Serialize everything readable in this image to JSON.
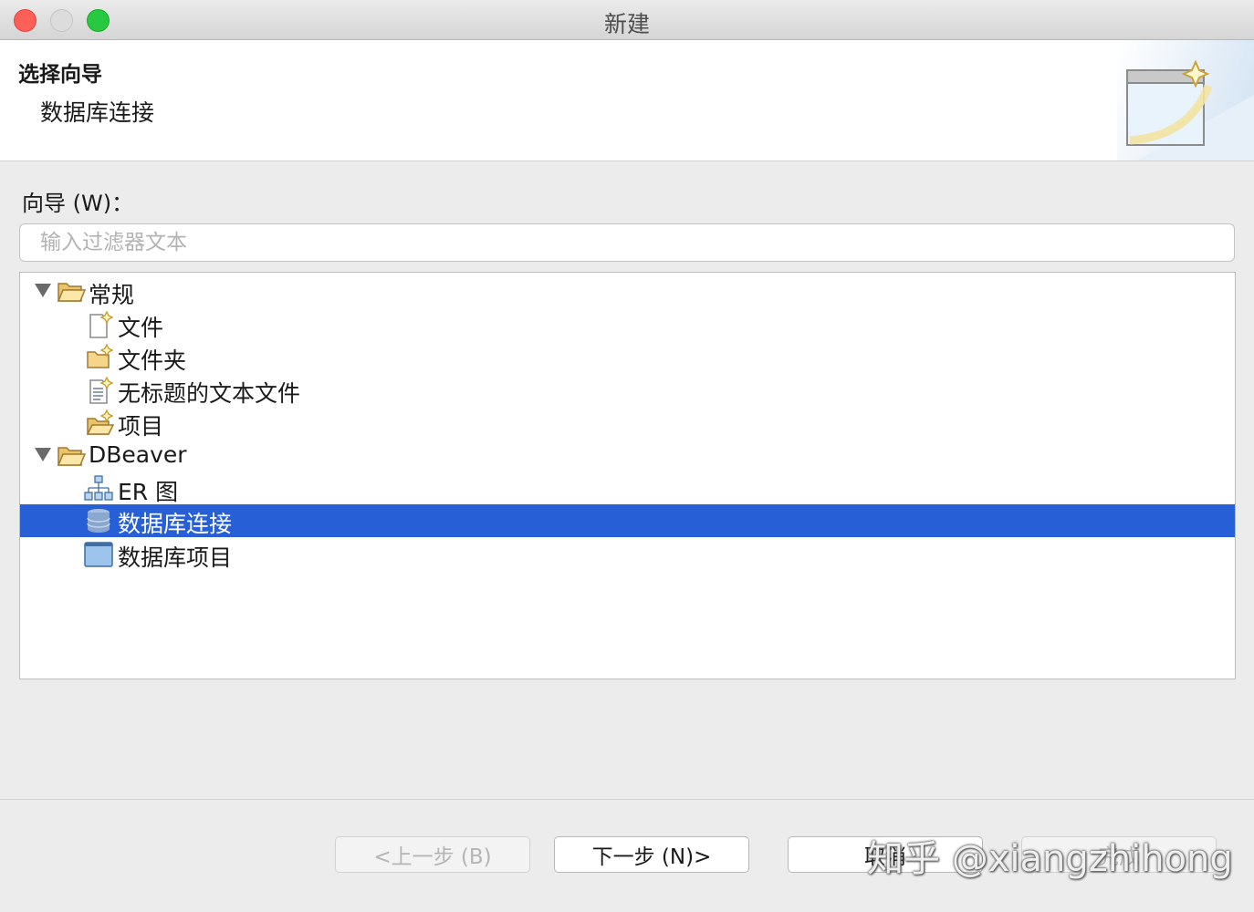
{
  "window": {
    "title": "新建"
  },
  "header": {
    "title": "选择向导",
    "description": "数据库连接"
  },
  "wizards": {
    "label": "向导 (W)：",
    "filter_placeholder": "输入过滤器文本",
    "tree": [
      {
        "label": "常规",
        "icon": "folder-open-icon",
        "expanded": true
      },
      {
        "label": "文件",
        "icon": "new-file-icon"
      },
      {
        "label": "文件夹",
        "icon": "new-folder-icon"
      },
      {
        "label": "无标题的文本文件",
        "icon": "new-text-file-icon"
      },
      {
        "label": "项目",
        "icon": "new-project-icon"
      },
      {
        "label": "DBeaver",
        "icon": "folder-open-icon",
        "expanded": true
      },
      {
        "label": "ER 图",
        "icon": "er-diagram-icon"
      },
      {
        "label": "数据库连接",
        "icon": "database-icon",
        "selected": true
      },
      {
        "label": "数据库项目",
        "icon": "database-project-icon"
      }
    ]
  },
  "buttons": {
    "back": "<上一步 (B)",
    "next": "下一步 (N)>",
    "cancel": "取消",
    "finish": "完成"
  },
  "watermark": "知乎 @xiangzhihong",
  "colors": {
    "selection": "#2760d6",
    "close": "#fe5f57",
    "maximize": "#28c840"
  }
}
